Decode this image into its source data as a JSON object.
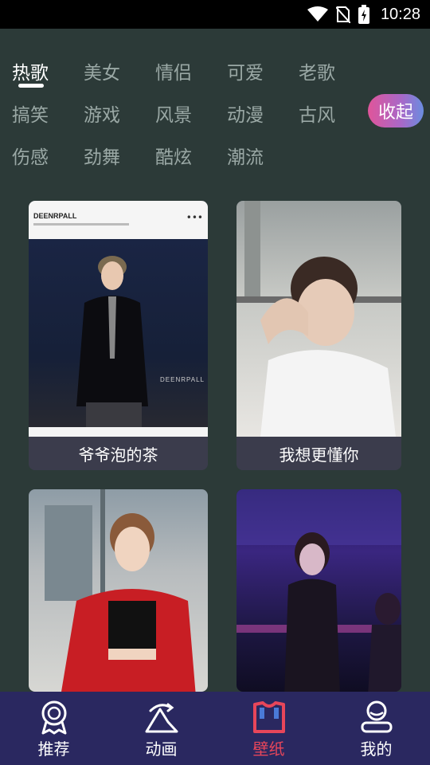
{
  "status_bar": {
    "time": "10:28"
  },
  "tags": {
    "row1": [
      "热歌",
      "美女",
      "情侣",
      "可爱",
      "老歌"
    ],
    "row2": [
      "搞笑",
      "游戏",
      "风景",
      "动漫",
      "古风"
    ],
    "row3": [
      "伤感",
      "劲舞",
      "酷炫",
      "潮流"
    ],
    "active": "热歌",
    "collapse_label": "收起"
  },
  "cards": [
    {
      "caption": "爷爷泡的茶",
      "brand": "DEENRPALL",
      "watermark": "DEENRPALL"
    },
    {
      "caption": "我想更懂你"
    },
    {
      "caption": ""
    },
    {
      "caption": ""
    }
  ],
  "bottom_nav": [
    {
      "label": "推荐",
      "icon": "medal-icon",
      "active": false
    },
    {
      "label": "动画",
      "icon": "animation-icon",
      "active": false
    },
    {
      "label": "壁纸",
      "icon": "wallpaper-shirt-icon",
      "active": true
    },
    {
      "label": "我的",
      "icon": "profile-icon",
      "active": false
    }
  ],
  "colors": {
    "background": "#2c3a38",
    "nav_background": "#2a2860",
    "active_nav": "#e8465a",
    "collapse_gradient": [
      "#e0559a",
      "#a868c8",
      "#6a8de0"
    ]
  }
}
